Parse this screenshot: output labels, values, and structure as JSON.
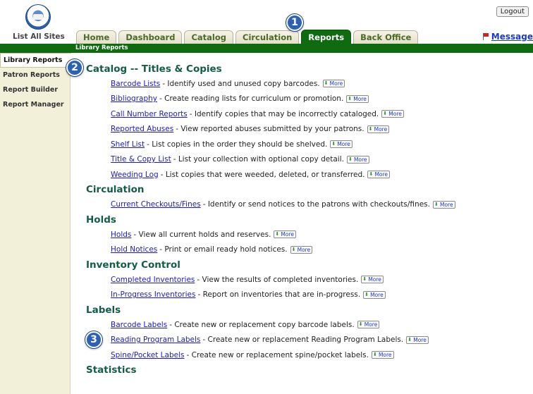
{
  "header": {
    "list_all_sites": "List All Sites",
    "logout": "Logout",
    "message": "Message",
    "breadcrumb": "Library Reports"
  },
  "tabs": [
    {
      "label": "Home",
      "active": false
    },
    {
      "label": "Dashboard",
      "active": false
    },
    {
      "label": "Catalog",
      "active": false
    },
    {
      "label": "Circulation",
      "active": false
    },
    {
      "label": "Reports",
      "active": true
    },
    {
      "label": "Back Office",
      "active": false
    }
  ],
  "sidebar": {
    "items": [
      {
        "label": "Library Reports",
        "active": true
      },
      {
        "label": "Patron Reports",
        "active": false
      },
      {
        "label": "Report Builder",
        "active": false
      },
      {
        "label": "Report Manager",
        "active": false
      }
    ]
  },
  "more_label": "More",
  "callouts": [
    "1",
    "2",
    "3"
  ],
  "sections": [
    {
      "title": "Catalog -- Titles & Copies",
      "reports": [
        {
          "link": "Barcode Lists",
          "desc": "- Identify used and unused copy barcodes."
        },
        {
          "link": "Bibliography",
          "desc": "- Create reading lists for curriculum or promotion."
        },
        {
          "link": "Call Number Reports",
          "desc": "- Identify copies that may be incorrectly cataloged."
        },
        {
          "link": "Reported Abuses",
          "desc": "- View reported abuses submitted by your patrons."
        },
        {
          "link": "Shelf List",
          "desc": "- List copies in the order they should be shelved."
        },
        {
          "link": "Title & Copy List",
          "desc": "- List your collection with optional copy detail."
        },
        {
          "link": "Weeding Log",
          "desc": "- List copies that were weeded, deleted, or transferred."
        }
      ]
    },
    {
      "title": "Circulation",
      "reports": [
        {
          "link": "Current Checkouts/Fines",
          "desc": "- Identify or send notices to the patrons with checkouts/fines."
        }
      ]
    },
    {
      "title": "Holds",
      "reports": [
        {
          "link": "Holds",
          "desc": "- View all current holds and reserves."
        },
        {
          "link": "Hold Notices",
          "desc": "- Print or email ready hold notices."
        }
      ]
    },
    {
      "title": "Inventory Control",
      "reports": [
        {
          "link": "Completed Inventories",
          "desc": "- View the results of completed inventories."
        },
        {
          "link": "In-Progress Inventories",
          "desc": "- Report on inventories that are in-progress."
        }
      ]
    },
    {
      "title": "Labels",
      "reports": [
        {
          "link": "Barcode Labels",
          "desc": "- Create new or replacement copy barcode labels."
        },
        {
          "link": "Reading Program Labels",
          "desc": "- Create new or replacement Reading Program Labels."
        },
        {
          "link": "Spine/Pocket Labels",
          "desc": "- Create new or replacement spine/pocket labels."
        }
      ]
    },
    {
      "title": "Statistics",
      "reports": []
    }
  ]
}
